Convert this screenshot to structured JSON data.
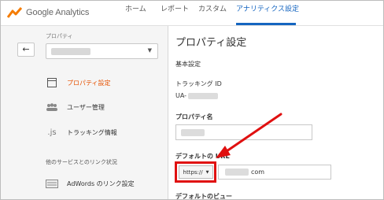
{
  "app": {
    "logo_text": "Google Analytics"
  },
  "nav": {
    "home": "ホーム",
    "reports": "レポート",
    "custom": "カスタム",
    "admin": "アナリティクス設定"
  },
  "sidebar": {
    "back_icon": "back-arrow-icon",
    "property_label": "プロパティ",
    "items": [
      {
        "label": "プロパティ設定",
        "icon": "property-icon"
      },
      {
        "label": "ユーザー管理",
        "icon": "users-icon"
      },
      {
        "label": "トラッキング情報",
        "icon": "js-icon",
        "icon_text": ".js"
      }
    ],
    "linked_header": "他のサービスとのリンク状況",
    "adwords": {
      "label": "AdWords のリンク設定",
      "icon": "adwords-icon"
    }
  },
  "main": {
    "title": "プロパティ設定",
    "section_basic": "基本設定",
    "tracking_id_label": "トラッキング ID",
    "tracking_id_prefix": "UA-",
    "property_name_label": "プロパティ名",
    "default_url_label": "デフォルトの URL",
    "protocol_value": "https://",
    "url_suffix": "com",
    "default_view_label": "デフォルトのビュー"
  },
  "colors": {
    "accent": "#1565c0",
    "active": "#e65100",
    "highlight": "#e01010"
  }
}
